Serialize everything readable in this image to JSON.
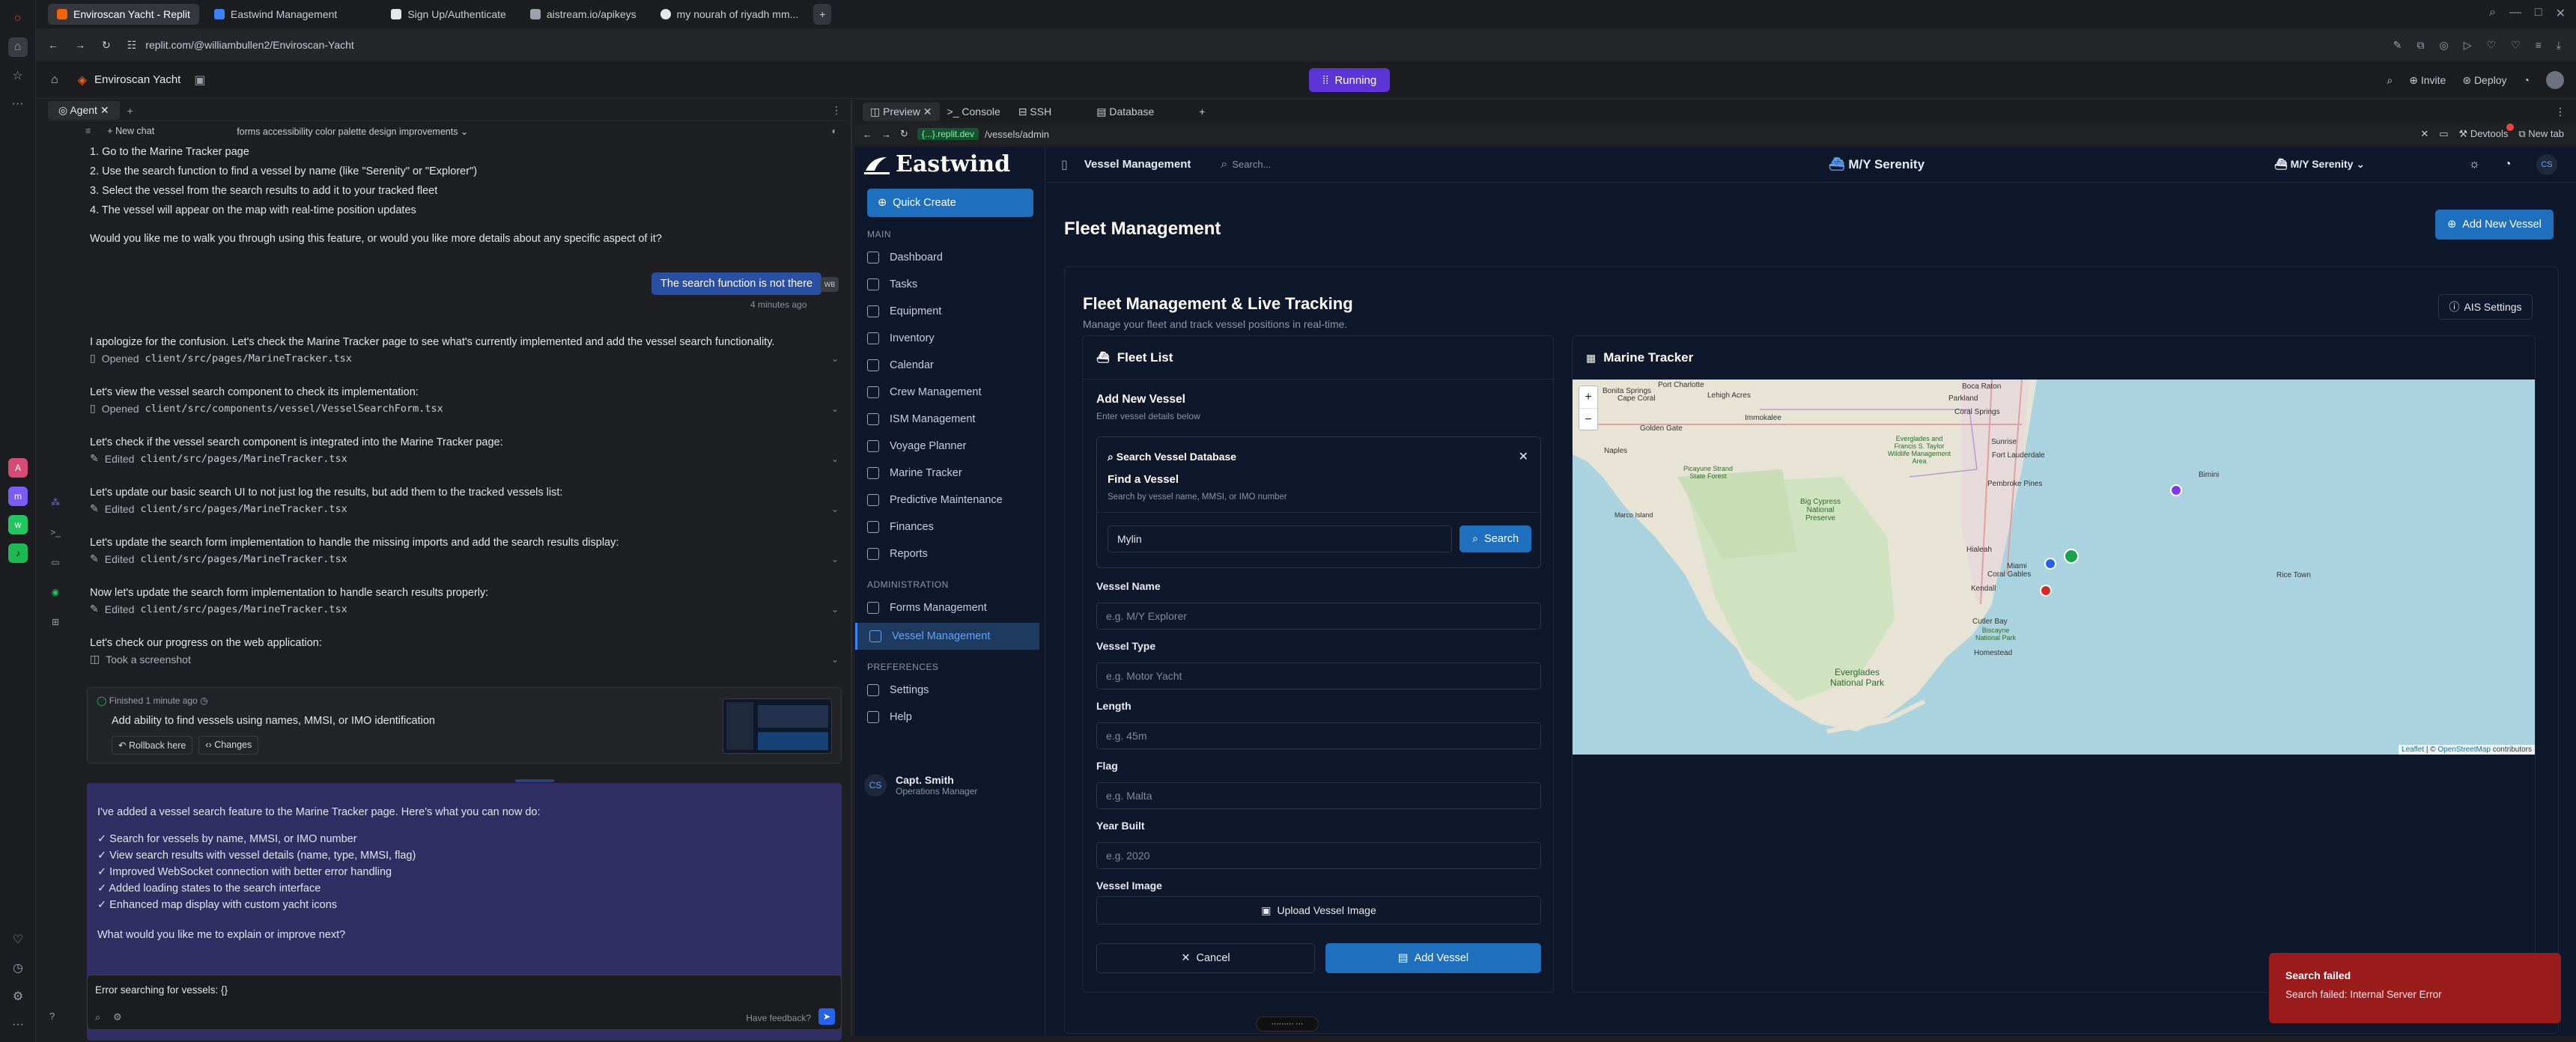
{
  "browser": {
    "tabs": [
      {
        "label": "Enviroscan Yacht - Replit",
        "color": "#f26207"
      },
      {
        "label": "Eastwind Management",
        "color": "#3b82f6"
      },
      {
        "label": "Sign Up/Authenticate",
        "color": "#e5e7eb"
      },
      {
        "label": "aistream.io/apikeys",
        "color": "#9ca3af"
      },
      {
        "label": "my nourah of riyadh mm...",
        "color": "#e5e7eb"
      }
    ],
    "url": "replit.com/@williambullen2/Enviroscan-Yacht"
  },
  "replit": {
    "project_name": "Enviroscan Yacht",
    "status": "Running",
    "invite": "Invite",
    "deploy": "Deploy"
  },
  "agent": {
    "tab": "Agent",
    "new_chat": "New chat",
    "thread_title": "forms accessibility color palette design improvements",
    "steps": [
      "1. Go to the Marine Tracker page",
      "2. Use the search function to find a vessel by name (like \"Serenity\" or \"Explorer\")",
      "3. Select the vessel from the search results to add it to your tracked fleet",
      "4. The vessel will appear on the map with real-time position updates"
    ],
    "question": "Would you like me to walk you through using this feature, or would you like more details about any specific aspect of it?",
    "user_message": "The search function is not there",
    "user_initials": "WB",
    "user_time": "4 minutes ago",
    "log": [
      {
        "text": "I apologize for the confusion. Let's check the Marine Tracker page to see what's currently implemented and add the vessel search functionality.",
        "action": "Opened",
        "file": "client/src/pages/MarineTracker.tsx"
      },
      {
        "text": "Let's view the vessel search component to check its implementation:",
        "action": "Opened",
        "file": "client/src/components/vessel/VesselSearchForm.tsx"
      },
      {
        "text": "Let's check if the vessel search component is integrated into the Marine Tracker page:",
        "action": "Edited",
        "file": "client/src/pages/MarineTracker.tsx"
      },
      {
        "text": "Let's update our basic search UI to not just log the results, but add them to the tracked vessels list:",
        "action": "Edited",
        "file": "client/src/pages/MarineTracker.tsx"
      },
      {
        "text": "Let's update the search form implementation to handle the missing imports and add the search results display:",
        "action": "Edited",
        "file": "client/src/pages/MarineTracker.tsx"
      },
      {
        "text": "Now let's update the search form implementation to handle search results properly:",
        "action": "Edited",
        "file": "client/src/pages/MarineTracker.tsx"
      }
    ],
    "progress_text": "Let's check our progress on the web application:",
    "screenshot_action": "Took a screenshot",
    "checkpoint": {
      "status": "Finished 1 minute ago",
      "title": "Add ability to find vessels using names, MMSI, or IMO identification",
      "rollback": "Rollback here",
      "changes": "Changes"
    },
    "summary": {
      "intro": "I've added a vessel search feature to the Marine Tracker page. Here's what you can now do:",
      "items": [
        "✓ Search for vessels by name, MMSI, or IMO number",
        "✓ View search results with vessel details (name, type, MMSI, flag)",
        "✓ Improved WebSocket connection with better error handling",
        "✓ Added loading states to the search interface",
        "✓ Enhanced map display with custom yacht icons"
      ],
      "outro": "What would you like me to explain or improve next?"
    },
    "input_value": "Error searching for vessels: {}",
    "feedback": "Have feedback?"
  },
  "devtools": {
    "tabs": [
      "Preview",
      "Console",
      "SSH",
      "Database"
    ],
    "domain": "{...}.replit.dev",
    "path": "/vessels/admin",
    "devtools": "Devtools",
    "new_tab": "New tab"
  },
  "app": {
    "brand": "Eastwind",
    "quick_create": "Quick Create",
    "sections": {
      "main": "MAIN",
      "administration": "ADMINISTRATION",
      "preferences": "PREFERENCES"
    },
    "nav_main": [
      "Dashboard",
      "Tasks",
      "Equipment",
      "Inventory",
      "Calendar",
      "Crew Management",
      "ISM Management",
      "Voyage Planner",
      "Marine Tracker",
      "Predictive Maintenance",
      "Finances",
      "Reports"
    ],
    "nav_admin": [
      "Forms Management",
      "Vessel Management"
    ],
    "nav_prefs": [
      "Settings",
      "Help"
    ],
    "user": {
      "initials": "CS",
      "name": "Capt. Smith",
      "role": "Operations Manager"
    },
    "top": {
      "section": "Vessel Management",
      "search_placeholder": "Search...",
      "vessel_center": "M/Y Serenity",
      "vessel_select": "M/Y Serenity",
      "avatar": "CS"
    },
    "page_title": "Fleet Management",
    "add_new_vessel": "Add New Vessel",
    "card_title": "Fleet Management & Live Tracking",
    "card_subtitle": "Manage your fleet and track vessel positions in real-time.",
    "ais_settings": "AIS Settings",
    "fleet_list": "Fleet List",
    "form": {
      "title": "Add New Vessel",
      "subtitle": "Enter vessel details below",
      "search_db": "Search Vessel Database",
      "find_title": "Find a Vessel",
      "find_sub": "Search by vessel name, MMSI, or IMO number",
      "search_value": "Mylin",
      "search_btn": "Search",
      "fields": [
        {
          "label": "Vessel Name",
          "placeholder": "e.g. M/Y Explorer"
        },
        {
          "label": "Vessel Type",
          "placeholder": "e.g. Motor Yacht"
        },
        {
          "label": "Length",
          "placeholder": "e.g. 45m"
        },
        {
          "label": "Flag",
          "placeholder": "e.g. Malta"
        },
        {
          "label": "Year Built",
          "placeholder": "e.g. 2020"
        }
      ],
      "image_label": "Vessel Image",
      "upload": "Upload Vessel Image",
      "cancel": "Cancel",
      "add": "Add Vessel"
    },
    "tracker_title": "Marine Tracker",
    "map": {
      "places": [
        "Boca Raton",
        "Parkland",
        "Coral Springs",
        "Sunrise",
        "Fort Lauderdale",
        "Pembroke Pines",
        "Hialeah",
        "Miami",
        "Coral Gables",
        "Kendall",
        "Cutler Bay",
        "Homestead",
        "Naples",
        "Marco Island",
        "Big Cypress National Preserve",
        "Everglades National Park",
        "Everglades and Francis S. Taylor Wildlife Management Area",
        "Picayune Strand State Forest",
        "Biscayne National Park",
        "Bimini",
        "Rice Town",
        "Port Charlotte",
        "Cape Coral",
        "Bonita Springs",
        "Lehigh Acres",
        "Golden Gate",
        "Immokalee"
      ],
      "zoom_in": "+",
      "zoom_out": "−",
      "attribution_leaflet": "Leaflet",
      "attribution_sep": " | © ",
      "attribution_osm": "OpenStreetMap",
      "attribution_tail": " contributors"
    },
    "toast": {
      "title": "Search failed",
      "message": "Search failed: Internal Server Error"
    }
  }
}
